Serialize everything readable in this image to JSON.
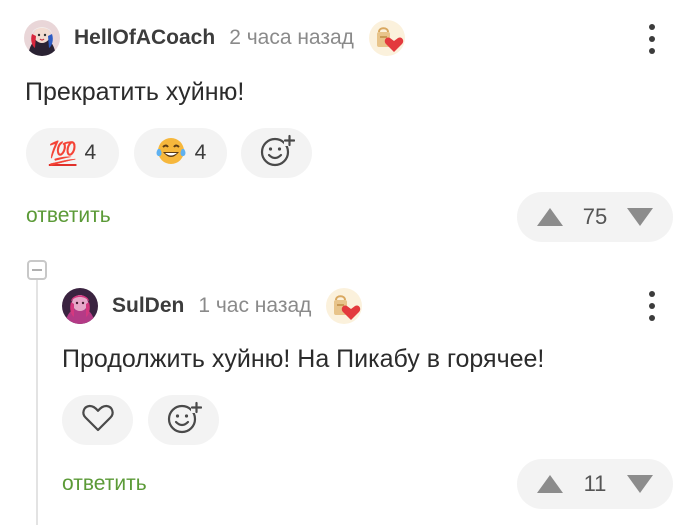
{
  "comments": [
    {
      "author": "HellOfACoach",
      "time": "2 часа назад",
      "text": "Прекратить хуйню!",
      "reactions": [
        {
          "emoji": "💯",
          "count": "4"
        },
        {
          "emoji": "😂",
          "count": "4"
        }
      ],
      "reply_label": "ответить",
      "score": "75"
    },
    {
      "author": "SulDen",
      "time": "1 час назад",
      "text": "Продолжить хуйню! На Пикабу в горячее!",
      "reply_label": "ответить",
      "score": "11"
    }
  ],
  "colors": {
    "reply_green": "#5b9a37",
    "pill_bg": "#f3f3f3",
    "vote_arrow": "#8c8c8c",
    "heart_red": "#e3393d"
  },
  "icons": [
    "avatar-image",
    "gift-heart-badge-icon",
    "more-vertical-icon",
    "hundred-points-emoji",
    "tears-of-joy-emoji",
    "add-reaction-icon",
    "heart-icon",
    "upvote-icon",
    "downvote-icon",
    "collapse-thread-icon"
  ]
}
